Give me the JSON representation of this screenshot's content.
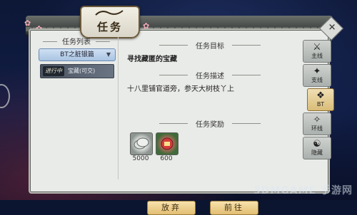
{
  "window": {
    "title": "任务",
    "close_icon": "close-icon"
  },
  "left_panel": {
    "header": "任务列表",
    "category": "BT之脏银篇",
    "quest_item": {
      "badge": "进行中",
      "name": "宝藏(可交)"
    }
  },
  "objective": {
    "header": "任务目标",
    "text": "寻找藏匿的宝藏"
  },
  "description": {
    "header": "任务描述",
    "text": "十八里铺官道旁，参天大树枝丫上"
  },
  "rewards": {
    "header": "任务奖励",
    "items": [
      {
        "icon": "silver-coin-icon",
        "value": "5000"
      },
      {
        "icon": "exp-gift-icon",
        "value": "600"
      }
    ]
  },
  "buttons": {
    "abandon": "放弃",
    "go": "前往"
  },
  "side_tabs": [
    {
      "icon": "main-quest-icon",
      "label": "主线"
    },
    {
      "icon": "side-quest-icon",
      "label": "支线"
    },
    {
      "icon": "bt-quest-icon",
      "label": "BT"
    },
    {
      "icon": "ring-quest-icon",
      "label": "环线"
    },
    {
      "icon": "hidden-quest-icon",
      "label": "隐藏"
    }
  ],
  "watermark": "3DMGAME 手游网"
}
